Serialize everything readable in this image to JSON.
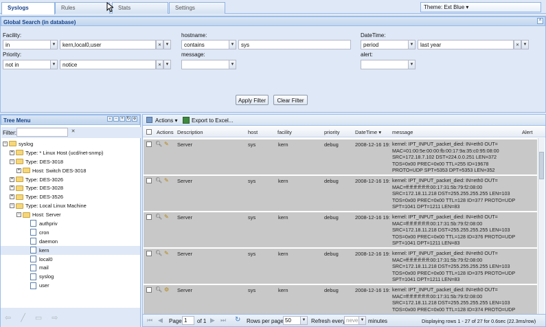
{
  "tabs": [
    {
      "label": "Syslogs"
    },
    {
      "label": "Rules"
    },
    {
      "label": "Stats"
    },
    {
      "label": "Settings"
    }
  ],
  "theme": {
    "label": "Theme: Ext Blue"
  },
  "search": {
    "title": "Global Search (in database)",
    "facility": {
      "label": "Facility:",
      "operator": "in",
      "value": "kern,local0,user"
    },
    "priority": {
      "label": "Priority:",
      "operator": "not in",
      "value": "notice"
    },
    "hostname": {
      "label": "hostname:",
      "operator": "contains",
      "value": "sys"
    },
    "message": {
      "label": "message:",
      "value": ""
    },
    "datetime": {
      "label": "DateTime:",
      "operator": "period",
      "value": "last year"
    },
    "alert": {
      "label": "alert:",
      "value": ""
    },
    "apply_label": "Apply Filter",
    "clear_label": "Clear Filter"
  },
  "tree": {
    "title": "Tree Menu",
    "filter_label": "Filter:",
    "nodes": [
      {
        "label": "syslog"
      },
      {
        "label": "Type: * Linux Host (ucd/net-snmp)"
      },
      {
        "label": "Type: DES-3018"
      },
      {
        "label": "Host: Switch DES-3018"
      },
      {
        "label": "Type: DES-3026"
      },
      {
        "label": "Type: DES-3028"
      },
      {
        "label": "Type: DES-3526"
      },
      {
        "label": "Type: Local Linux Machine"
      },
      {
        "label": "Host: Server"
      },
      {
        "label": "authpriv"
      },
      {
        "label": "cron"
      },
      {
        "label": "daemon"
      },
      {
        "label": "kern"
      },
      {
        "label": "local0"
      },
      {
        "label": "mail"
      },
      {
        "label": "syslog"
      },
      {
        "label": "user"
      }
    ]
  },
  "toolbar": {
    "actions_label": "Actions",
    "export_label": "Export to Excel..."
  },
  "grid": {
    "columns": [
      "Actions",
      "Description",
      "host",
      "facility",
      "priority",
      "DateTime",
      "message",
      "Alert"
    ],
    "rows": [
      {
        "description": "Server",
        "host": "sys",
        "facility": "kern",
        "priority": "debug",
        "datetime": "2008-12-16 19:",
        "message": [
          "kernel: IPT_INPUT_packet_died: IN=eth0 OUT=",
          "MAC=01:00:5e:00:00:fb:00:17:9a:35:c0:95:08:00",
          "SRC=172.18.7.102 DST=224.0.0.251 LEN=372",
          "TOS=0x00 PREC=0x00 TTL=255 ID=19678",
          "PROTO=UDP SPT=5353 DPT=5353 LEN=352"
        ]
      },
      {
        "description": "Server",
        "host": "sys",
        "facility": "kern",
        "priority": "debug",
        "datetime": "2008-12-16 19:",
        "message": [
          "kernel: IPT_INPUT_packet_died: IN=eth0 OUT=",
          "MAC=ff:ff:ff:ff:ff:ff:00:17:31:5b:79:f2:08:00",
          "SRC=172.18.11.218 DST=255.255.255.255 LEN=103",
          "TOS=0x00 PREC=0x00 TTL=128 ID=377 PROTO=UDP",
          "SPT=1041 DPT=1211 LEN=83"
        ]
      },
      {
        "description": "Server",
        "host": "sys",
        "facility": "kern",
        "priority": "debug",
        "datetime": "2008-12-16 19:",
        "message": [
          "kernel: IPT_INPUT_packet_died: IN=eth0 OUT=",
          "MAC=ff:ff:ff:ff:ff:ff:00:17:31:5b:79:f2:08:00",
          "SRC=172.18.11.218 DST=255.255.255.255 LEN=103",
          "TOS=0x00 PREC=0x00 TTL=128 ID=376 PROTO=UDP",
          "SPT=1041 DPT=1211 LEN=83"
        ]
      },
      {
        "description": "Server",
        "host": "sys",
        "facility": "kern",
        "priority": "debug",
        "datetime": "2008-12-16 19:",
        "message": [
          "kernel: IPT_INPUT_packet_died: IN=eth0 OUT=",
          "MAC=ff:ff:ff:ff:ff:ff:00:17:31:5b:79:f2:08:00",
          "SRC=172.18.11.218 DST=255.255.255.255 LEN=103",
          "TOS=0x00 PREC=0x00 TTL=128 ID=375 PROTO=UDP",
          "SPT=1041 DPT=1211 LEN=83"
        ]
      },
      {
        "description": "Server",
        "host": "sys",
        "facility": "kern",
        "priority": "debug",
        "datetime": "2008-12-16 19:",
        "message": [
          "kernel: IPT_INPUT_packet_died: IN=eth0 OUT=",
          "MAC=ff:ff:ff:ff:ff:ff:00:17:31:5b:79:f2:08:00",
          "SRC=172.18.11.218 DST=255.255.255.255 LEN=103",
          "TOS=0x00 PREC=0x00 TTL=128 ID=374 PROTO=UDP"
        ]
      }
    ]
  },
  "paging": {
    "page_label": "Page",
    "page_value": "1",
    "of_label": "of 1",
    "rpp_label": "Rows per page:",
    "rpp_value": "50",
    "refresh_label": "Refresh every",
    "refresh_value": "never",
    "minutes_label": "minutes",
    "display_text": "Displaying rows 1 - 27 of 27 for 0.6sec (22.3ms/row)"
  }
}
